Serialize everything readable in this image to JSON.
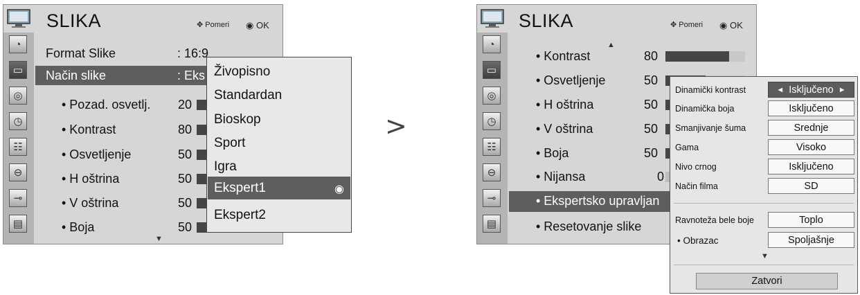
{
  "left": {
    "title": "SLIKA",
    "hint_move": "Pomeri",
    "hint_ok": "OK",
    "icons": [
      "satellite-icon",
      "tv-picture-icon",
      "audio-icon",
      "clock-icon",
      "option-icon",
      "lock-icon",
      "input-icon",
      "usb-photo-icon"
    ],
    "rows": {
      "format_label": "Format Slike",
      "format_value": ": 16:9",
      "mode_label": "Način slike",
      "mode_value": ": Eks",
      "backlight_label": "• Pozad. osvetlj.",
      "backlight_value": "20",
      "contrast_label": "• Kontrast",
      "contrast_value": "80",
      "brightness_label": "• Osvetljenje",
      "brightness_value": "50",
      "hsharp_label": "• H oštrina",
      "hsharp_value": "50",
      "vsharp_label": "• V oštrina",
      "vsharp_value": "50",
      "color_label": "• Boja",
      "color_value": "50"
    },
    "dropdown": [
      "Živopisno",
      "Standardan",
      "Bioskop",
      "Sport",
      "Igra",
      "Ekspert1",
      "Ekspert2"
    ],
    "dropdown_selected": "Ekspert1"
  },
  "arrow": ">",
  "right": {
    "title": "SLIKA",
    "hint_move": "Pomeri",
    "hint_ok": "OK",
    "rows": {
      "contrast_label": "• Kontrast",
      "contrast_value": "80",
      "brightness_label": "• Osvetljenje",
      "brightness_value": "50",
      "hsharp_label": "• H oštrina",
      "hsharp_value": "50",
      "vsharp_label": "• V oštrina",
      "vsharp_value": "50",
      "color_label": "• Boja",
      "color_value": "50",
      "tint_label": "• Nijansa",
      "tint_value": "0",
      "expert_label": "• Ekspertsko upravljan",
      "reset_label": "• Resetovanje slike"
    },
    "bars": {
      "contrast": 0.8,
      "brightness": 0.5
    },
    "sub": {
      "dyn_contrast_label": "Dinamički kontrast",
      "dyn_contrast_value": "Isključeno",
      "dyn_color_label": "Dinamička boja",
      "dyn_color_value": "Isključeno",
      "noise_label": "Smanjivanje šuma",
      "noise_value": "Srednje",
      "gamma_label": "Gama",
      "gamma_value": "Visoko",
      "black_label": "Nivo crnog",
      "black_value": "Isključeno",
      "film_label": "Način filma",
      "film_value": "SD",
      "wb_label": "Ravnoteža bele boje",
      "wb_value": "Toplo",
      "pattern_label": "• Obrazac",
      "pattern_value": "Spoljašnje",
      "close_label": "Zatvori"
    }
  }
}
